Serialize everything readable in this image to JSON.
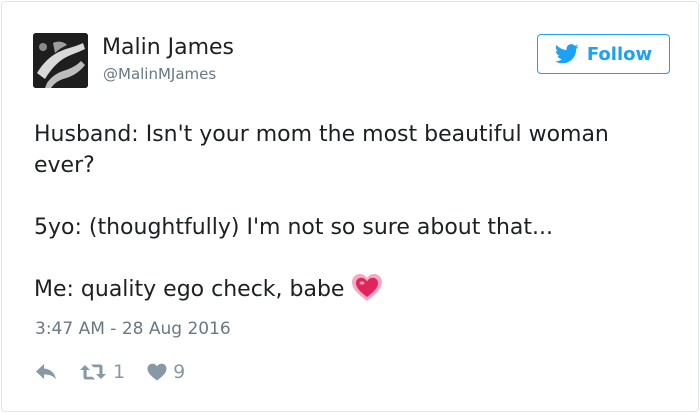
{
  "author": {
    "display_name": "Malin James",
    "handle": "@MalinMJames"
  },
  "follow_button": {
    "label": "Follow"
  },
  "tweet": {
    "lines": [
      "Husband: Isn't your mom the most beautiful woman",
      "ever?",
      "5yo: (thoughtfully) I'm not so sure about that...",
      "Me: quality ego check, babe"
    ],
    "emoji": "sparkling-heart",
    "timestamp": "3:47 AM - 28 Aug 2016"
  },
  "actions": {
    "reply_icon": "reply-icon",
    "retweet_icon": "retweet-icon",
    "retweet_count": "1",
    "like_icon": "heart-icon",
    "like_count": "9"
  },
  "colors": {
    "twitter_blue": "#1da1f2",
    "text": "#1c2022",
    "muted": "#697882",
    "action_gray": "#8899a6",
    "border": "#e1e8ed",
    "heart_pink": "#e0245e"
  }
}
